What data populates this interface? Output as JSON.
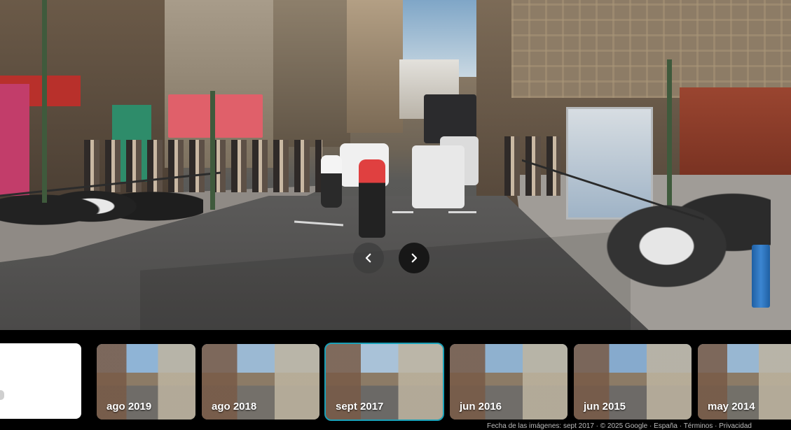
{
  "navigation": {
    "prev_icon": "chevron-left-icon",
    "next_icon": "chevron-right-icon"
  },
  "timeline": {
    "items": [
      {
        "label": "ago 2019",
        "selected": false,
        "sky": "#8fb4d6",
        "ground": "#6f6c68"
      },
      {
        "label": "ago 2018",
        "selected": false,
        "sky": "#9bb9d3",
        "ground": "#74706a"
      },
      {
        "label": "sept 2017",
        "selected": true,
        "sky": "#a9c2d8",
        "ground": "#6b6966"
      },
      {
        "label": "jun 2016",
        "selected": false,
        "sky": "#8fb1cf",
        "ground": "#706d69"
      },
      {
        "label": "jun 2015",
        "selected": false,
        "sky": "#86aacd",
        "ground": "#6d6a67"
      },
      {
        "label": "may 2014",
        "selected": false,
        "sky": "#98b7d2",
        "ground": "#737069"
      }
    ],
    "footer": "Fecha de las imágenes: sept 2017 · © 2025 Google · España · Términos · Privacidad"
  },
  "colors": {
    "selected_outline": "#1aa1b8"
  }
}
